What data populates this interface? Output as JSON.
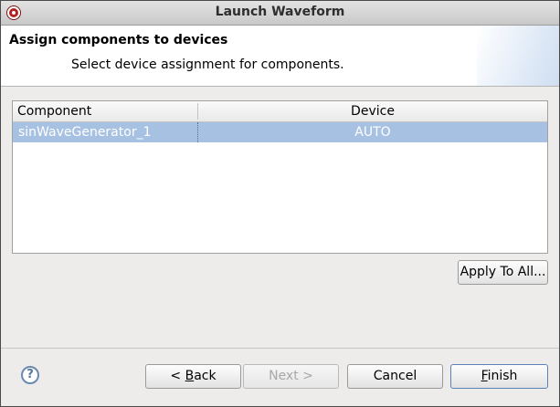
{
  "window": {
    "title": "Launch Waveform",
    "icon": "app-icon"
  },
  "header": {
    "title": "Assign components to devices",
    "description": "Select device assignment for components."
  },
  "table": {
    "columns": [
      "Component",
      "Device"
    ],
    "rows": [
      {
        "component": "sinWaveGenerator_1",
        "device": "AUTO",
        "selected": true
      }
    ]
  },
  "buttons": {
    "apply_to_all": "Apply To All...",
    "back_prefix": "< ",
    "back_mnemonic": "B",
    "back_rest": "ack",
    "next": "Next >",
    "cancel": "Cancel",
    "finish_mnemonic": "F",
    "finish_rest": "inish"
  },
  "help": {
    "icon": "help-icon",
    "glyph": "?"
  },
  "colors": {
    "selection": "#a7c1e2",
    "banner_bg": "#ffffff",
    "dialog_bg": "#edeceb"
  }
}
